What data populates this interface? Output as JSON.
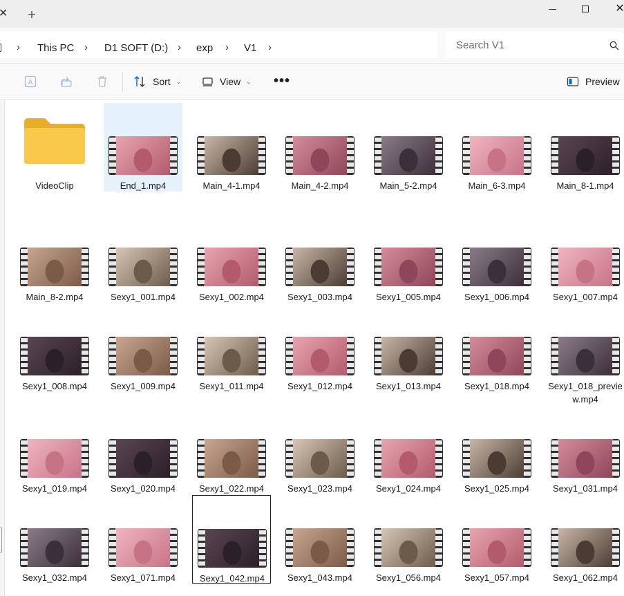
{
  "window": {
    "tab_close_glyph": "✕",
    "new_tab_glyph": "+",
    "minimize_icon": "minimize-icon",
    "maximize_icon": "maximize-icon",
    "close_icon": "close-icon"
  },
  "breadcrumb": {
    "items": [
      "This PC",
      "D1 SOFT (D:)",
      "exp",
      "V1"
    ],
    "separator": "›"
  },
  "search": {
    "placeholder": "Search V1"
  },
  "toolbar": {
    "rename_icon": "rename-icon",
    "share_icon": "share-icon",
    "delete_icon": "delete-icon",
    "sort_label": "Sort",
    "view_label": "View",
    "more_label": "•••",
    "preview_label": "Preview"
  },
  "colors": {
    "accent": "#0067c0",
    "folder": "#f8c94a",
    "selected_bg": "#e5f1fb"
  },
  "files": [
    {
      "name": "VideoClip",
      "type": "folder"
    },
    {
      "name": "End_1.mp4",
      "type": "video",
      "selected": true
    },
    {
      "name": "Main_4-1.mp4",
      "type": "video"
    },
    {
      "name": "Main_4-2.mp4",
      "type": "video"
    },
    {
      "name": "Main_5-2.mp4",
      "type": "video"
    },
    {
      "name": "Main_6-3.mp4",
      "type": "video"
    },
    {
      "name": "Main_8-1.mp4",
      "type": "video"
    },
    {
      "name": "Main_8-2.mp4",
      "type": "video"
    },
    {
      "name": "Sexy1_001.mp4",
      "type": "video"
    },
    {
      "name": "Sexy1_002.mp4",
      "type": "video"
    },
    {
      "name": "Sexy1_003.mp4",
      "type": "video"
    },
    {
      "name": "Sexy1_005.mp4",
      "type": "video"
    },
    {
      "name": "Sexy1_006.mp4",
      "type": "video"
    },
    {
      "name": "Sexy1_007.mp4",
      "type": "video"
    },
    {
      "name": "Sexy1_008.mp4",
      "type": "video"
    },
    {
      "name": "Sexy1_009.mp4",
      "type": "video"
    },
    {
      "name": "Sexy1_011.mp4",
      "type": "video"
    },
    {
      "name": "Sexy1_012.mp4",
      "type": "video"
    },
    {
      "name": "Sexy1_013.mp4",
      "type": "video"
    },
    {
      "name": "Sexy1_018.mp4",
      "type": "video"
    },
    {
      "name": "Sexy1_018_preview.mp4",
      "type": "video"
    },
    {
      "name": "Sexy1_019.mp4",
      "type": "video"
    },
    {
      "name": "Sexy1_020.mp4",
      "type": "video"
    },
    {
      "name": "Sexy1_022.mp4",
      "type": "video"
    },
    {
      "name": "Sexy1_023.mp4",
      "type": "video"
    },
    {
      "name": "Sexy1_024.mp4",
      "type": "video"
    },
    {
      "name": "Sexy1_025.mp4",
      "type": "video"
    },
    {
      "name": "Sexy1_031.mp4",
      "type": "video"
    },
    {
      "name": "Sexy1_032.mp4",
      "type": "video"
    },
    {
      "name": "Sexy1_071.mp4",
      "type": "video"
    },
    {
      "name": "Sexy1_042.mp4",
      "type": "video",
      "focused": true
    },
    {
      "name": "Sexy1_043.mp4",
      "type": "video"
    },
    {
      "name": "Sexy1_056.mp4",
      "type": "video"
    },
    {
      "name": "Sexy1_057.mp4",
      "type": "video"
    },
    {
      "name": "Sexy1_062.mp4",
      "type": "video"
    }
  ]
}
